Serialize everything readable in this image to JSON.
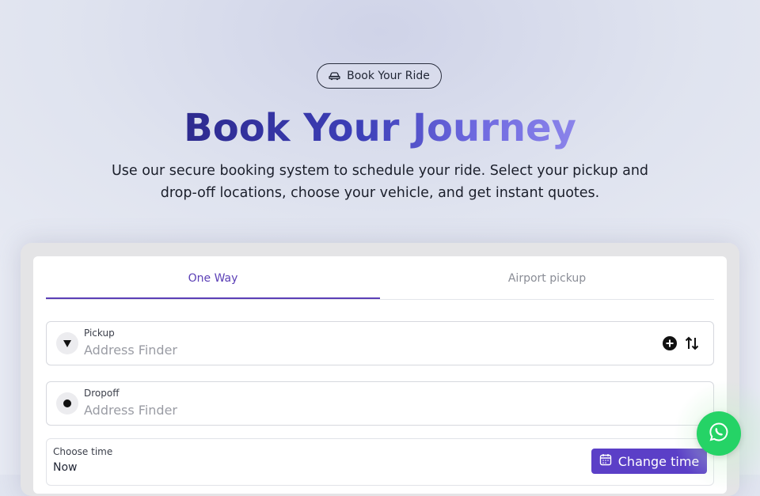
{
  "hero": {
    "badge_label": "Book Your Ride",
    "badge_icon": "car-icon",
    "title": "Book Your Journey",
    "subtitle": "Use our secure booking system to schedule your ride. Select your pickup and drop-off locations, choose your vehicle, and get instant quotes."
  },
  "tabs": [
    {
      "label": "One Way",
      "active": true
    },
    {
      "label": "Airport pickup",
      "active": false
    }
  ],
  "pickup": {
    "label": "Pickup",
    "placeholder": "Address Finder",
    "icon": "pin-icon",
    "actions": [
      "add-stop-icon",
      "swap-icon"
    ]
  },
  "dropoff": {
    "label": "Dropoff",
    "placeholder": "Address Finder",
    "icon": "dot-icon"
  },
  "time": {
    "label": "Choose time",
    "value": "Now",
    "button_label": "Change time",
    "button_icon": "calendar-icon"
  },
  "whatsapp": {
    "icon": "whatsapp-icon"
  },
  "colors": {
    "accent": "#5b3fc7",
    "title_gradient_start": "#2d2a8e",
    "title_gradient_end": "#8b84ea",
    "whatsapp": "#25d366"
  }
}
